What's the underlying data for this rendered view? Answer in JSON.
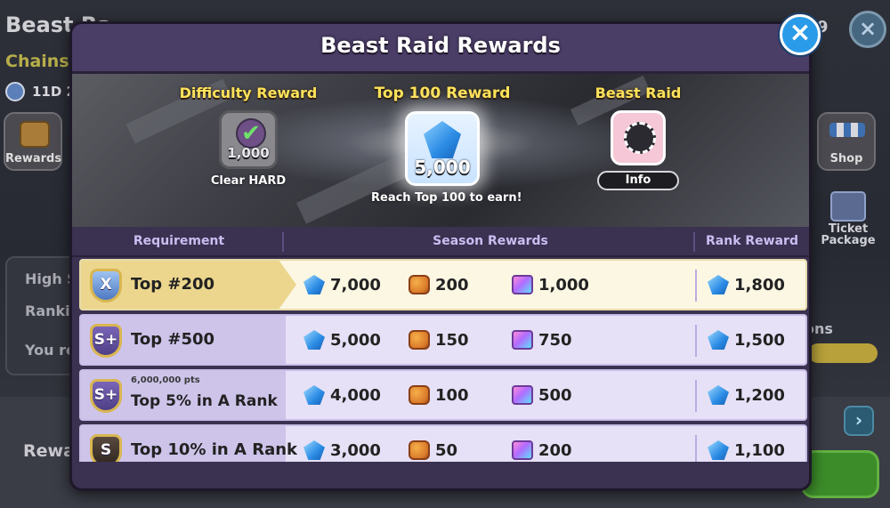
{
  "background": {
    "title": "Beast Ra",
    "subtitle": "Chains c",
    "timer": "11D 2",
    "rewards_button": "Rewards",
    "panel_line1": "High S",
    "panel_line2": "Ranki",
    "panel_line3": "You re",
    "bottom_label": "Rewa",
    "shop_button": "Shop",
    "ticket_package": "Ticket Package",
    "side_text": "ons",
    "top_right_number": "9",
    "arrow_icon": "chevron-right-icon"
  },
  "modal": {
    "title": "Beast Raid Rewards",
    "close_icon": "close-icon"
  },
  "banner": {
    "difficulty": {
      "heading": "Difficulty Reward",
      "value": "1,000",
      "caption": "Clear HARD",
      "icon": "checkmark-icon"
    },
    "top100": {
      "heading": "Top 100 Reward",
      "value": "5,000",
      "caption": "Reach Top 100 to earn!",
      "icon": "crystal-icon"
    },
    "beast_raid": {
      "heading": "Beast Raid",
      "info_label": "Info",
      "icon": "beast-raid-icon"
    }
  },
  "table": {
    "headers": {
      "requirement": "Requirement",
      "season_rewards": "Season Rewards",
      "rank_reward": "Rank Reward"
    },
    "rows": [
      {
        "label": "Top #200",
        "sub": "",
        "badge": "X",
        "crystals": "7,000",
        "cookies": "200",
        "cubes": "1,000",
        "rank": "1,800"
      },
      {
        "label": "Top #500",
        "sub": "",
        "badge": "S+",
        "crystals": "5,000",
        "cookies": "150",
        "cubes": "750",
        "rank": "1,500"
      },
      {
        "label": "Top 5% in A Rank",
        "sub": "6,000,000 pts",
        "badge": "S+",
        "crystals": "4,000",
        "cookies": "100",
        "cubes": "500",
        "rank": "1,200"
      },
      {
        "label": "Top 10% in A Rank",
        "sub": "",
        "badge": "S",
        "crystals": "3,000",
        "cookies": "50",
        "cubes": "200",
        "rank": "1,100"
      }
    ]
  },
  "colors": {
    "modal_bg": "#3b3151",
    "header_gold": "#ffe25a",
    "highlight_row": "#fbf7e3",
    "row_bg": "#e6e1f6",
    "close_button": "#2a9be8"
  }
}
